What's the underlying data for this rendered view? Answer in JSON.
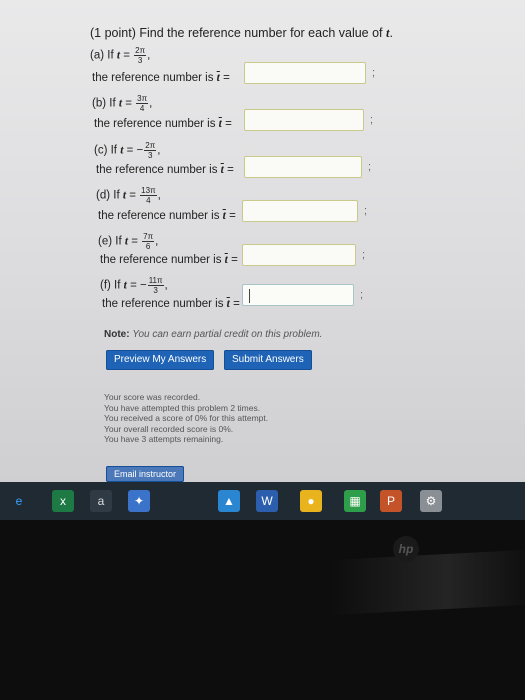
{
  "problem": {
    "title": "(1 point) Find the reference number for each value of",
    "title_var": "t",
    "parts": [
      {
        "label": "(a) If",
        "sign": "",
        "num": "2π",
        "den": "3",
        "prompt": "the reference number is",
        "value": ""
      },
      {
        "label": "(b) If",
        "sign": "",
        "num": "3π",
        "den": "4",
        "prompt": "the reference number is",
        "value": ""
      },
      {
        "label": "(c) If",
        "sign": "−",
        "num": "2π",
        "den": "3",
        "prompt": "the reference number is",
        "value": ""
      },
      {
        "label": "(d) If",
        "sign": "",
        "num": "13π",
        "den": "4",
        "prompt": "the reference number is",
        "value": ""
      },
      {
        "label": "(e) If",
        "sign": "",
        "num": "7π",
        "den": "6",
        "prompt": "the reference number is",
        "value": ""
      },
      {
        "label": "(f) If",
        "sign": "−",
        "num": "11π",
        "den": "3",
        "prompt": "the reference number is",
        "value": ""
      }
    ],
    "var": "t",
    "equals": "=",
    "semicolon": ";",
    "comma": ","
  },
  "note": {
    "label": "Note:",
    "text": "You can earn partial credit on this problem."
  },
  "buttons": {
    "preview": "Preview My Answers",
    "submit": "Submit Answers",
    "email": "Email instructor"
  },
  "score": {
    "lines": [
      "Your score was recorded.",
      "You have attempted this problem 2 times.",
      "You received a score of 0% for this attempt.",
      "Your overall recorded score is 0%.",
      "You have 3 attempts remaining."
    ]
  },
  "taskbar": {
    "icons": [
      "edge-icon",
      "excel-icon",
      "amazon-icon",
      "dropbox-icon",
      "photos-icon",
      "word-icon",
      "chrome-icon",
      "store-icon",
      "powerpoint-icon",
      "settings-icon"
    ]
  },
  "brand": "hp"
}
